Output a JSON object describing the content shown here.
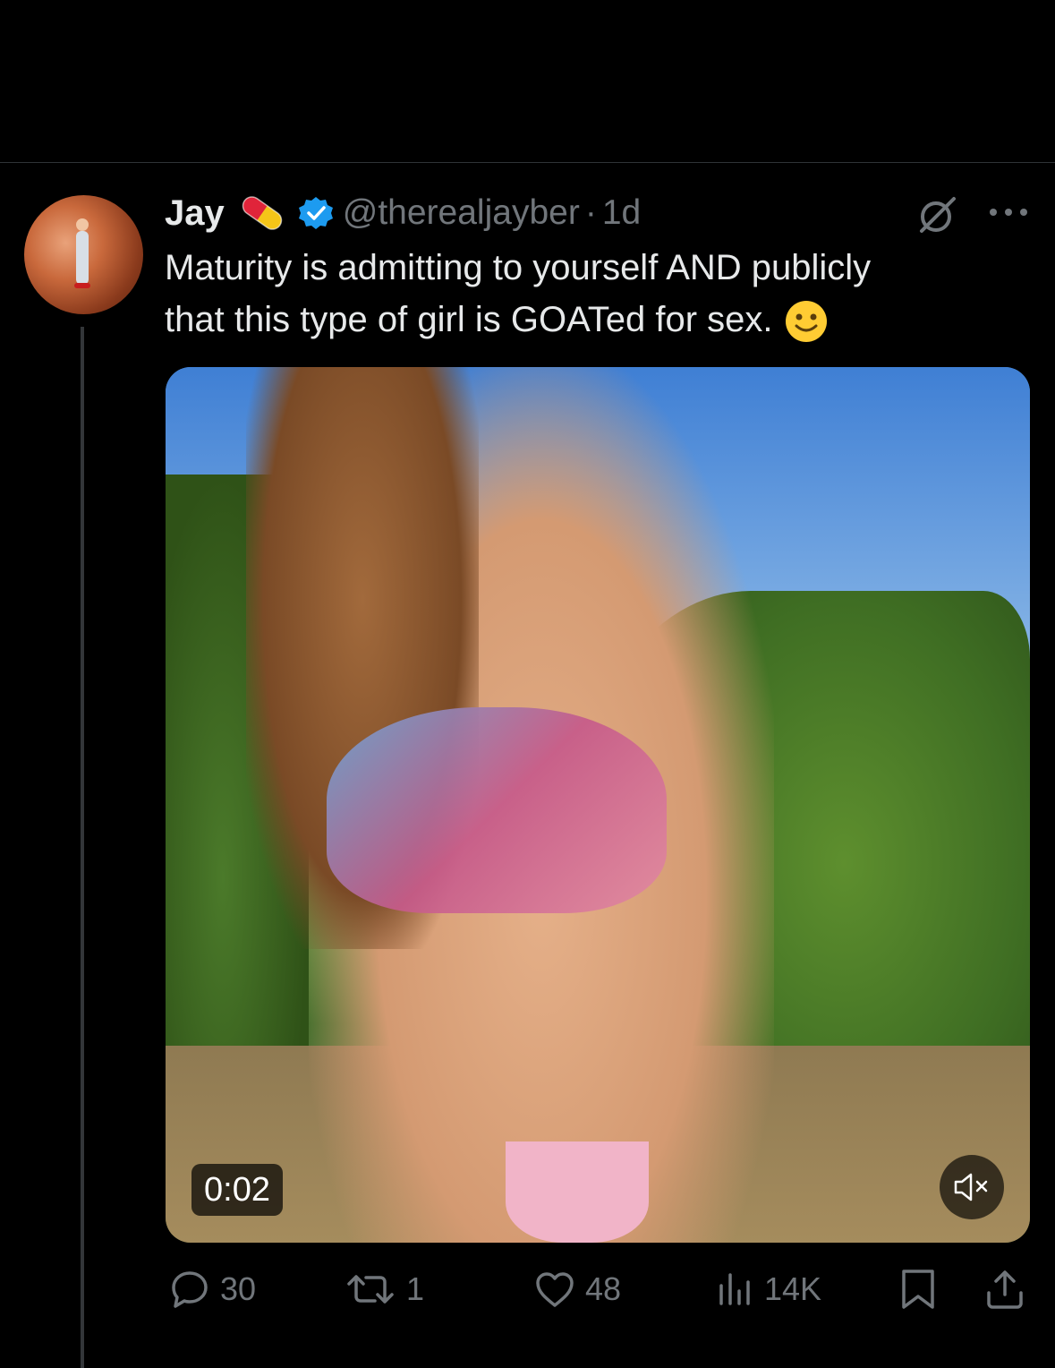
{
  "tweet": {
    "author": {
      "display_name": "Jay",
      "name_emoji": "pill-icon",
      "verified": true,
      "handle": "@therealjayber",
      "separator": "·",
      "time": "1d",
      "avatar": "avatar"
    },
    "text_line1": "Maturity is admitting to yourself AND publicly",
    "text_line2": "that this type of girl is GOATed for sex.",
    "text_emoji": "slightly-smiling-face",
    "media": {
      "type": "video",
      "duration": "0:02",
      "muted": true
    },
    "actions": {
      "replies": "30",
      "reposts": "1",
      "likes": "48",
      "views": "14K"
    }
  },
  "colors": {
    "background": "#000000",
    "text_primary": "#e7e9ea",
    "text_secondary": "#71767b",
    "verified_blue": "#1d9bf0",
    "divider": "#2f3336"
  }
}
